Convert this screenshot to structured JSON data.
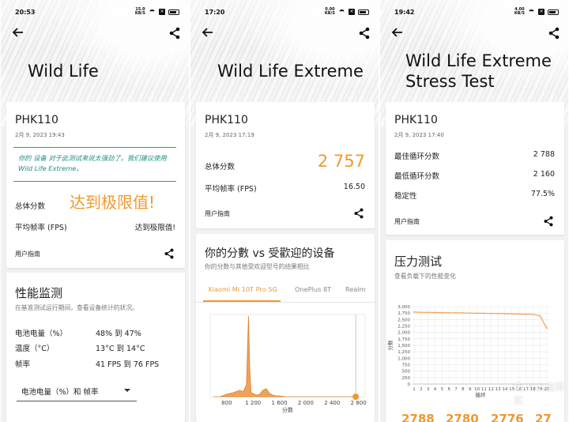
{
  "panels": [
    {
      "status": {
        "time": "20:53",
        "net_top": "15.0",
        "net_bottom": "KB/S"
      },
      "title": "Wild Life",
      "device": {
        "name": "PHK110",
        "date": "2月 9, 2023 19:43"
      },
      "warning": "你的 设备 对于此测试来说太强劲了。我们建议使用 Wild Life Extreme。",
      "score_label": "总体分数",
      "score_value": "达到极限值!",
      "fps_label": "平均帧率 (FPS)",
      "fps_value": "达到极限值!",
      "guide": "用户指南",
      "monitor": {
        "title": "性能监测",
        "subtitle": "在基准测试运行期间，查看设备统计的状况。",
        "rows": [
          {
            "label": "电池电量（%）",
            "value": "48% 到 47%"
          },
          {
            "label": "温度（°C）",
            "value": "13°C 到 14°C"
          },
          {
            "label": "帧率",
            "value": "41 FPS 到 76 FPS"
          }
        ],
        "dropdown": "电池电量（%）和 帧率"
      }
    },
    {
      "status": {
        "time": "17:20",
        "net_top": "0.00",
        "net_bottom": "KB/S"
      },
      "title": "Wild Life Extreme",
      "device": {
        "name": "PHK110",
        "date": "2月 9, 2023 17:19"
      },
      "score_label": "总体分数",
      "score_value": "2 757",
      "fps_label": "平均帧率 (FPS)",
      "fps_value": "16.50",
      "guide": "用户指南",
      "compare": {
        "title": "你的分數 vs 受歡迎的设备",
        "subtitle": "你的分数与其他受欢迎型号的结果相比",
        "tabs": [
          "Xiaomi Mi 10T Pro 5G",
          "OnePlus 8T",
          "Realm"
        ],
        "active_tab": 0
      }
    },
    {
      "status": {
        "time": "19:42",
        "net_top": "4.00",
        "net_bottom": "KB/S"
      },
      "title_line1": "Wild Life Extreme",
      "title_line2": "Stress Test",
      "device": {
        "name": "PHK110",
        "date": "2月 9, 2023 17:40"
      },
      "rows": [
        {
          "label": "最佳循环分数",
          "value": "2 788"
        },
        {
          "label": "最低循环分数",
          "value": "2 160"
        },
        {
          "label": "稳定性",
          "value": "77.5%"
        }
      ],
      "guide": "用户指南",
      "stress": {
        "title": "压力测试",
        "subtitle": "查看负载下的性能变化",
        "stubs": [
          "2788",
          "2780",
          "2776",
          "27"
        ]
      }
    }
  ],
  "watermark": "值 什么值得买",
  "accent_color": "#f0992e",
  "chart_data": [
    {
      "type": "area",
      "title": "",
      "xlabel": "分数",
      "ylabel": "",
      "x_ticks": [
        "800",
        "1 200",
        "1 600",
        "2 000",
        "2 400",
        "2 800"
      ],
      "xlim": [
        550,
        2900
      ],
      "x": [
        600,
        700,
        800,
        900,
        1000,
        1050,
        1100,
        1130,
        1150,
        1170,
        1200,
        1250,
        1300,
        1350,
        1400,
        1450,
        1500,
        1550,
        1600,
        1700,
        2000,
        2400,
        2800
      ],
      "values": [
        0,
        0,
        0.03,
        0.05,
        0.08,
        0.06,
        0.15,
        1.0,
        0.35,
        0.05,
        0.04,
        0.02,
        0.03,
        0.08,
        0.1,
        0.04,
        0.02,
        0.01,
        0.01,
        0,
        0,
        0,
        0
      ],
      "your_score": 2757
    },
    {
      "type": "line",
      "title": "",
      "xlabel": "循环",
      "ylabel": "分数",
      "ylim": [
        0,
        3000
      ],
      "y_ticks": [
        "0",
        "250",
        "500",
        "750",
        "1,000",
        "1,250",
        "1,500",
        "1,750",
        "2,000",
        "2,250",
        "2,500",
        "2,750",
        "3,000"
      ],
      "x_ticks": [
        "1",
        "2",
        "3",
        "4",
        "5",
        "6",
        "7",
        "8",
        "9",
        "10",
        "11",
        "12",
        "13",
        "14",
        "15",
        "16",
        "17",
        "18",
        "19",
        "20"
      ],
      "x": [
        1,
        2,
        3,
        4,
        5,
        6,
        7,
        8,
        9,
        10,
        11,
        12,
        13,
        14,
        15,
        16,
        17,
        18,
        19,
        20
      ],
      "values": [
        2788,
        2780,
        2776,
        2772,
        2768,
        2762,
        2758,
        2754,
        2748,
        2744,
        2740,
        2735,
        2730,
        2724,
        2718,
        2712,
        2706,
        2700,
        2650,
        2160
      ]
    }
  ]
}
